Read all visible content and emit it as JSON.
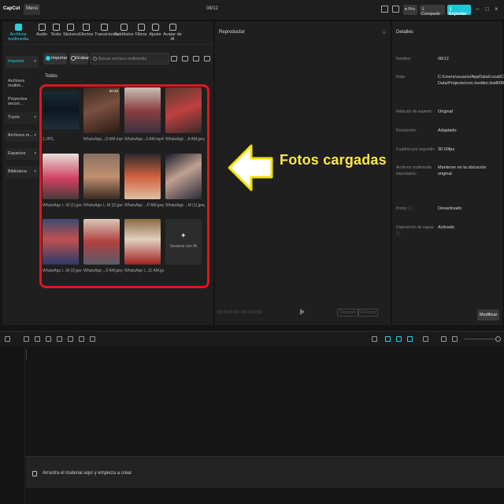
{
  "app": {
    "logo": "CapCut",
    "menu_label": "Menú",
    "project_title": "08/12",
    "pro_label": "Pro",
    "share_label": "Compartir",
    "export_label": "Exportar",
    "accent_color": "#2ad0e0"
  },
  "toolbar": {
    "tools": [
      {
        "label": "Archivos multimedia",
        "icon": "media-icon",
        "active": true
      },
      {
        "label": "Audio",
        "icon": "audio-icon"
      },
      {
        "label": "Texto",
        "icon": "text-icon"
      },
      {
        "label": "Stickers",
        "icon": "sticker-icon"
      },
      {
        "label": "Efectos",
        "icon": "effects-icon"
      },
      {
        "label": "Transiciones",
        "icon": "transition-icon"
      },
      {
        "label": "Subtítulos",
        "icon": "subtitles-icon"
      },
      {
        "label": "Filtros",
        "icon": "filter-icon"
      },
      {
        "label": "Ajuste",
        "icon": "adjust-icon"
      },
      {
        "label": "Avatar de IA",
        "icon": "avatar-icon"
      }
    ]
  },
  "sidebar": {
    "items": [
      {
        "label": "Importar",
        "active": true,
        "chevron": true
      },
      {
        "label": "Archivos multim...",
        "active": false,
        "chevron": false
      },
      {
        "label": "Proyectos secun...",
        "active": false,
        "chevron": false
      },
      {
        "label": "Tuyos",
        "active": false,
        "chevron": true
      },
      {
        "label": "Archivos m...",
        "active": false,
        "chevron": true
      },
      {
        "label": "Espacios",
        "active": false,
        "chevron": true
      },
      {
        "label": "Biblioteca",
        "active": false,
        "chevron": true
      }
    ]
  },
  "media": {
    "import_label": "Importar",
    "record_label": "Grabar",
    "search_placeholder": "Buscar archivos multimedia",
    "section_label": "Todos",
    "files": [
      {
        "name": "1.JPG",
        "duration": ""
      },
      {
        "name": "WhatsApp...(3 AM.mp4",
        "duration": "00:49"
      },
      {
        "name": "WhatsApp...3 AM.mp4",
        "duration": ""
      },
      {
        "name": "WhatsApp ...8 AM.jpeg",
        "duration": ""
      },
      {
        "name": "WhatsApp I...M (1).jpeg",
        "duration": ""
      },
      {
        "name": "WhatsApp I...M (2).jpeg",
        "duration": ""
      },
      {
        "name": "WhatsApp ...P AM.jpeg",
        "duration": ""
      },
      {
        "name": "WhatsApp ...M (1).jpeg",
        "duration": ""
      },
      {
        "name": "WhatsApp I...M (2).jpeg",
        "duration": ""
      },
      {
        "name": "WhatsApp ...0 AM.jpeg",
        "duration": ""
      },
      {
        "name": "WhatsApp I...11 AM.jpeg",
        "duration": ""
      }
    ],
    "generate_ai_label": "Generar con IA"
  },
  "player": {
    "title": "Reproductor",
    "time": "00:00:00:00 / 00:00:00:00",
    "full_label": "Completo",
    "ratio_label": "Relación"
  },
  "annotation": {
    "text": "Fotos cargadas",
    "color": "#ffe84a"
  },
  "details": {
    "title": "Detalles",
    "rows": [
      {
        "key": "Nombre:",
        "value": "08/12"
      },
      {
        "key": "Ruta:",
        "value": "C:/Users/usuario/AppData/Local/CapCut/User Data/Projects/com.lveditor.draft/08/12"
      },
      {
        "key": "Relación de aspecto:",
        "value": "Original"
      },
      {
        "key": "Resolución:",
        "value": "Adaptado"
      },
      {
        "key": "Cuadros por segundo:",
        "value": "30.00fps"
      },
      {
        "key": "Archivos multimedia importados:",
        "value": "Mantener en la ubicación original"
      },
      {
        "key": "Proxy: ⓘ",
        "value": "Desactivado"
      },
      {
        "key": "Disposición de capas: ⓘ",
        "value": "Activado"
      }
    ],
    "modify_label": "Modificar"
  },
  "timeline": {
    "drop_text": "Arrastra el material aquí y empieza a crear"
  }
}
